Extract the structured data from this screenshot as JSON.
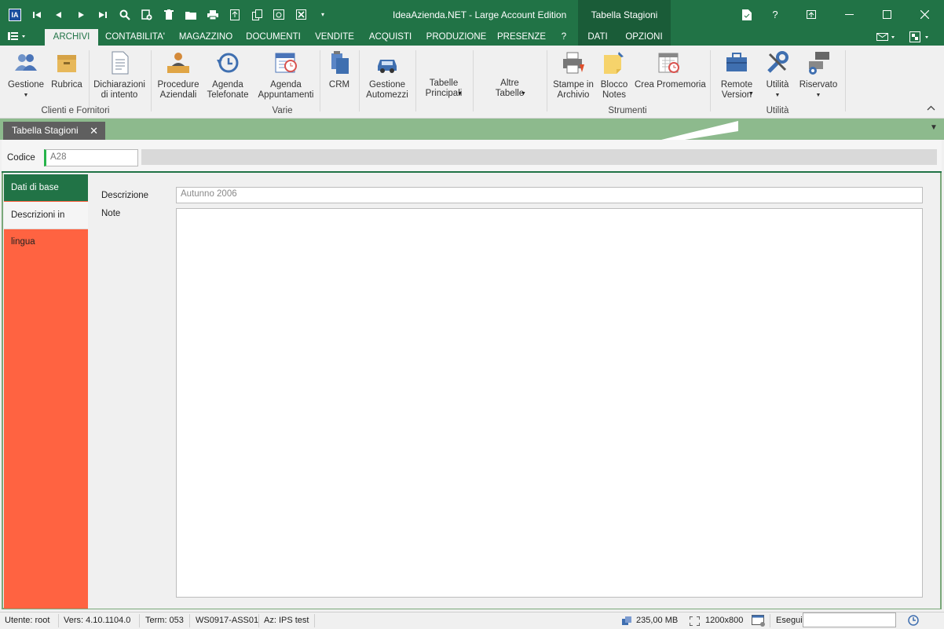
{
  "window": {
    "title": "IdeaAzienda.NET - Large Account Edition",
    "context_tab_title": "Tabella Stagioni",
    "app_icon": "IA"
  },
  "quick_access": [
    "app-icon",
    "first-icon",
    "prev-icon",
    "next-icon",
    "last-icon",
    "search-icon",
    "new-icon",
    "delete-icon",
    "open-folder-icon",
    "print-icon",
    "export-icon",
    "copy-icon",
    "preview-icon",
    "close-doc-icon",
    "customize-icon"
  ],
  "ribbon_tabs": [
    {
      "label": "ARCHIVI",
      "active": true
    },
    {
      "label": "CONTABILITA'"
    },
    {
      "label": "MAGAZZINO"
    },
    {
      "label": "DOCUMENTI"
    },
    {
      "label": "VENDITE"
    },
    {
      "label": "ACQUISTI"
    },
    {
      "label": "PRODUZIONE"
    },
    {
      "label": "PRESENZE"
    },
    {
      "label": "?"
    },
    {
      "label": "DATI"
    },
    {
      "label": "OPZIONI"
    }
  ],
  "ribbon": {
    "buttons": [
      {
        "label": "Gestione",
        "icon": "users-icon",
        "dropdown": true
      },
      {
        "label": "Rubrica",
        "icon": "box-icon"
      },
      {
        "label": "Dichiarazioni\ndi intento",
        "icon": "document-icon"
      },
      {
        "label": "Procedure\nAziendali",
        "icon": "person-desk-icon"
      },
      {
        "label": "Agenda\nTelefonate",
        "icon": "history-icon"
      },
      {
        "label": "Agenda\nAppuntamenti",
        "icon": "calendar-clock-icon"
      },
      {
        "label": "CRM",
        "icon": "crm-icon"
      },
      {
        "label": "Gestione\nAutomezzi",
        "icon": "car-icon"
      },
      {
        "label": "Tabelle\nPrincipali",
        "icon": "",
        "dropdown": true
      },
      {
        "label": "Altre\nTabelle",
        "icon": "",
        "dropdown": true
      },
      {
        "label": "Stampe in\nArchivio",
        "icon": "printer-icon"
      },
      {
        "label": "Blocco\nNotes",
        "icon": "sticky-note-icon"
      },
      {
        "label": "Crea Promemoria",
        "icon": "calendar-reminder-icon"
      },
      {
        "label": "Remote\nVersion",
        "icon": "briefcase-icon",
        "dropdown": true
      },
      {
        "label": "Utilità",
        "icon": "tools-icon",
        "dropdown": true
      },
      {
        "label": "Riservato",
        "icon": "gear-network-icon",
        "dropdown": true
      }
    ],
    "groups": [
      "Clienti e Fornitori",
      "Varie",
      "Strumenti",
      "Utilità"
    ]
  },
  "document_tab": {
    "label": "Tabella Stagioni"
  },
  "form": {
    "codice_label": "Codice",
    "codice_value": "A28",
    "nav": [
      {
        "label": "Dati di base",
        "active": true
      },
      {
        "label": "Descrizioni in lingua",
        "active": false
      }
    ],
    "descrizione_label": "Descrizione",
    "descrizione_value": "Autunno 2006",
    "note_label": "Note",
    "note_value": ""
  },
  "status": {
    "user": "Utente: root",
    "version": "Vers: 4.10.1104.0",
    "term": "Term: 053",
    "workstation": "WS0917-ASS01",
    "company": "Az: IPS test",
    "memory": "235,00 MB",
    "resolution": "1200x800",
    "esegui_label": "Esegui"
  },
  "colors": {
    "accent": "#217346",
    "sidebar": "#ff6341",
    "doctabs": "#8dba8d"
  }
}
